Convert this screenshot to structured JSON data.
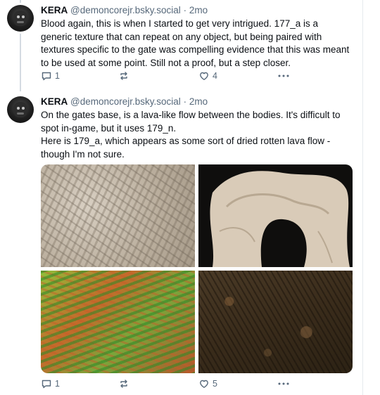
{
  "posts": [
    {
      "author": "KERA",
      "handle": "@demoncorejr.bsky.social",
      "separator": "·",
      "age": "2mo",
      "text": [
        "Blood again, this is when I started to get very intrigued. 177_a is a generic texture that can repeat on any object, but being paired with textures specific to the gate was compelling evidence that this was meant to be used at some point. Still not a proof, but a step closer."
      ],
      "replies": "1",
      "likes": "4"
    },
    {
      "author": "KERA",
      "handle": "@demoncorejr.bsky.social",
      "separator": "·",
      "age": "2mo",
      "text": [
        "On the gates base, is a lava-like flow between the bodies. It's difficult to spot in-game, but it uses 179_n.",
        "Here is 179_a, which appears as some sort of dried rotten lava flow - though I'm not sure."
      ],
      "replies": "1",
      "likes": "5"
    }
  ],
  "icons": [
    "reply-icon",
    "repost-icon",
    "like-icon",
    "more-icon"
  ],
  "colors": {
    "meta_text": "#56687a",
    "thread_line": "#d4dbe2",
    "icon": "#56687a"
  }
}
